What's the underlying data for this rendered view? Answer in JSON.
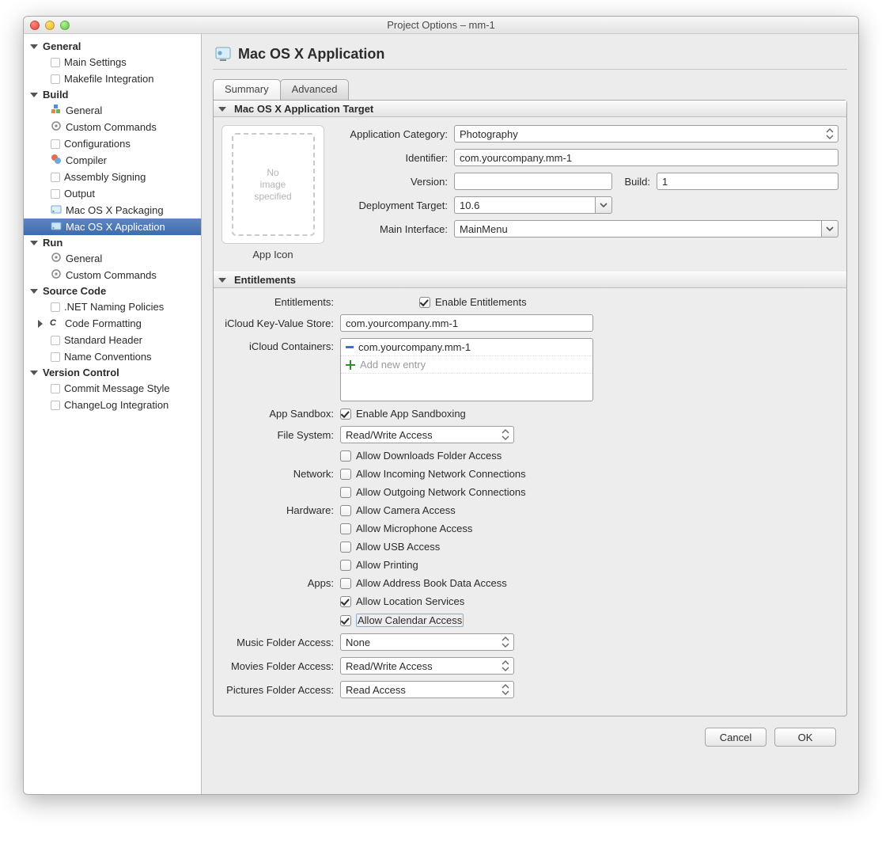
{
  "window": {
    "title": "Project Options – mm-1"
  },
  "sidebar": {
    "groups": [
      {
        "label": "General",
        "items": [
          {
            "label": "Main Settings",
            "icon": "cb"
          },
          {
            "label": "Makefile Integration",
            "icon": "cb"
          }
        ]
      },
      {
        "label": "Build",
        "items": [
          {
            "label": "General",
            "icon": "build"
          },
          {
            "label": "Custom Commands",
            "icon": "gear"
          },
          {
            "label": "Configurations",
            "icon": "cb"
          },
          {
            "label": "Compiler",
            "icon": "compiler"
          },
          {
            "label": "Assembly Signing",
            "icon": "cb"
          },
          {
            "label": "Output",
            "icon": "cb"
          },
          {
            "label": "Mac OS X Packaging",
            "icon": "pkg"
          },
          {
            "label": "Mac OS X Application",
            "icon": "app",
            "selected": true
          }
        ]
      },
      {
        "label": "Run",
        "items": [
          {
            "label": "General",
            "icon": "gear"
          },
          {
            "label": "Custom Commands",
            "icon": "gear"
          }
        ]
      },
      {
        "label": "Source Code",
        "items": [
          {
            "label": ".NET Naming Policies",
            "icon": "cb"
          },
          {
            "label": "Code Formatting",
            "icon": "cf",
            "expandable": true
          },
          {
            "label": "Standard Header",
            "icon": "cb"
          },
          {
            "label": "Name Conventions",
            "icon": "cb"
          }
        ]
      },
      {
        "label": "Version Control",
        "items": [
          {
            "label": "Commit Message Style",
            "icon": "cb"
          },
          {
            "label": "ChangeLog Integration",
            "icon": "cb"
          }
        ]
      }
    ]
  },
  "page": {
    "title": "Mac OS X Application",
    "tabs": [
      "Summary",
      "Advanced"
    ],
    "active_tab": 0
  },
  "target_section": {
    "title": "Mac OS X Application Target",
    "app_icon_placeholder": "No\nimage\nspecified",
    "app_icon_caption": "App Icon",
    "fields": {
      "category_label": "Application Category:",
      "category_value": "Photography",
      "identifier_label": "Identifier:",
      "identifier_value": "com.yourcompany.mm-1",
      "version_label": "Version:",
      "version_value": "",
      "build_label": "Build:",
      "build_value": "1",
      "deploy_label": "Deployment Target:",
      "deploy_value": "10.6",
      "main_if_label": "Main Interface:",
      "main_if_value": "MainMenu"
    }
  },
  "ent_section": {
    "title": "Entitlements",
    "entitlements_label": "Entitlements:",
    "enable_entitlements_label": "Enable Entitlements",
    "enable_entitlements_checked": true,
    "kv_label": "iCloud Key-Value Store:",
    "kv_value": "com.yourcompany.mm-1",
    "containers_label": "iCloud Containers:",
    "container_entry": "com.yourcompany.mm-1",
    "add_entry_placeholder": "Add new entry",
    "sandbox_label": "App Sandbox:",
    "enable_sandbox_label": "Enable App Sandboxing",
    "enable_sandbox_checked": true,
    "fs_label": "File System:",
    "fs_value": "Read/Write Access",
    "downloads_label": "Allow Downloads Folder Access",
    "downloads_checked": false,
    "network_label": "Network:",
    "net_in_label": "Allow Incoming Network Connections",
    "net_in_checked": false,
    "net_out_label": "Allow Outgoing Network Connections",
    "net_out_checked": false,
    "hardware_label": "Hardware:",
    "cam_label": "Allow Camera Access",
    "cam_checked": false,
    "mic_label": "Allow Microphone Access",
    "mic_checked": false,
    "usb_label": "Allow USB Access",
    "usb_checked": false,
    "print_label": "Allow Printing",
    "print_checked": false,
    "apps_label": "Apps:",
    "addr_label": "Allow Address Book Data Access",
    "addr_checked": false,
    "loc_label": "Allow Location Services",
    "loc_checked": true,
    "cal_label": "Allow Calendar Access",
    "cal_checked": true,
    "music_label": "Music Folder Access:",
    "music_value": "None",
    "movies_label": "Movies Folder Access:",
    "movies_value": "Read/Write Access",
    "pics_label": "Pictures Folder Access:",
    "pics_value": "Read Access"
  },
  "footer": {
    "cancel": "Cancel",
    "ok": "OK"
  }
}
